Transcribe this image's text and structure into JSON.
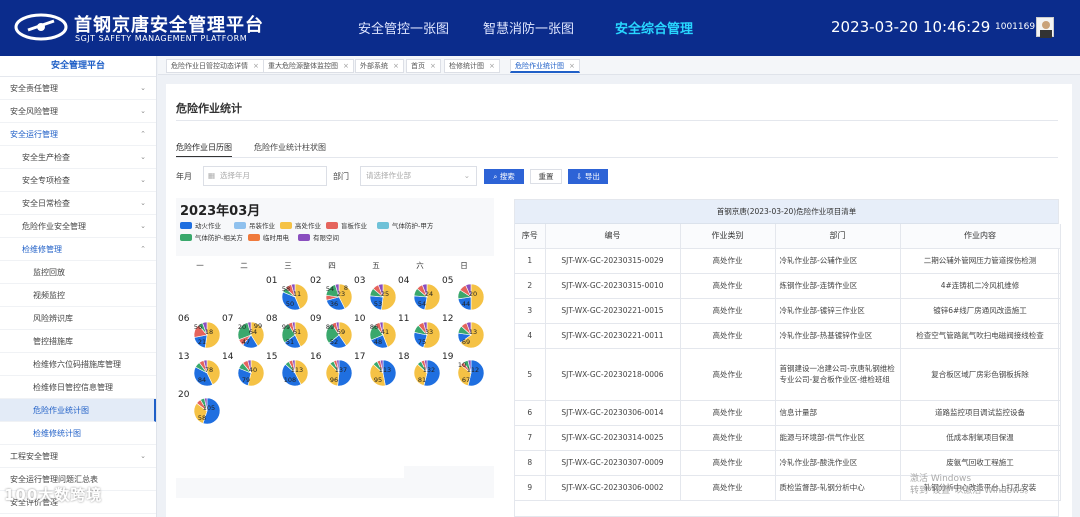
{
  "header": {
    "title": "首钢京唐安全管理平台",
    "subtitle": "SGJT SAFETY MANAGEMENT PLATFORM",
    "nav": [
      "安全管控一张图",
      "智慧消防一张图",
      "安全综合管理"
    ],
    "active_nav": "安全综合管理",
    "datetime": "2023-03-20 10:46:29",
    "user_id": "10011691"
  },
  "sidebar": {
    "title": "安全管理平台",
    "items": [
      {
        "label": "安全责任管理",
        "level": 1,
        "chevron": "⌄"
      },
      {
        "label": "安全风险管理",
        "level": 1,
        "chevron": "⌄"
      },
      {
        "label": "安全运行管理",
        "level": 1,
        "chevron": "⌃"
      },
      {
        "label": "安全生产检查",
        "level": 2,
        "chevron": "⌄"
      },
      {
        "label": "安全专项检查",
        "level": 2,
        "chevron": "⌄"
      },
      {
        "label": "安全日常检查",
        "level": 2,
        "chevron": "⌄"
      },
      {
        "label": "危险作业安全管理",
        "level": 2,
        "chevron": "⌄"
      },
      {
        "label": "检维修管理",
        "level": 2,
        "chevron": "⌃"
      },
      {
        "label": "监控回放",
        "level": 3,
        "chevron": ""
      },
      {
        "label": "视频监控",
        "level": 3,
        "chevron": ""
      },
      {
        "label": "风险辨识库",
        "level": 3,
        "chevron": ""
      },
      {
        "label": "管控措施库",
        "level": 3,
        "chevron": ""
      },
      {
        "label": "检维修六位码措施库管理",
        "level": 3,
        "chevron": ""
      },
      {
        "label": "检维修日管控信息管理",
        "level": 3,
        "chevron": ""
      },
      {
        "label": "危险作业统计图",
        "level": 3,
        "chevron": ""
      },
      {
        "label": "检维修统计图",
        "level": 3,
        "chevron": ""
      },
      {
        "label": "工程安全管理",
        "level": 1,
        "chevron": "⌄"
      },
      {
        "label": "安全运行管理问题汇总表",
        "level": 1,
        "chevron": ""
      },
      {
        "label": "安全评价管理",
        "level": 1,
        "chevron": ""
      }
    ]
  },
  "tabs": [
    {
      "label": "危险作业日管控动态详情"
    },
    {
      "label": "重大危险源整体监控图"
    },
    {
      "label": "外部系统"
    },
    {
      "label": "首页"
    },
    {
      "label": "检修统计图"
    },
    {
      "label": "危险作业统计图"
    }
  ],
  "page": {
    "title": "危险作业统计",
    "subtabs": [
      "危险作业日历图",
      "危险作业统计柱状图"
    ],
    "filters": {
      "month_label": "年月",
      "month_placeholder": "选择年月",
      "dept_label": "部门",
      "dept_placeholder": "请选择作业部"
    },
    "buttons": {
      "search": "搜索",
      "reset": "重置",
      "export": "导出"
    }
  },
  "calendar": {
    "title": "2023年03月",
    "weekdays": [
      "一",
      "二",
      "三",
      "四",
      "五",
      "六",
      "日"
    ],
    "legend": [
      {
        "name": "动火作业",
        "color": "#1f6fe0"
      },
      {
        "name": "吊装作业",
        "color": "#8fc1ee"
      },
      {
        "name": "高处作业",
        "color": "#f5c245"
      },
      {
        "name": "盲板作业",
        "color": "#e5645c"
      },
      {
        "name": "气体防护-甲方",
        "color": "#6fc2d8"
      },
      {
        "name": "气体防护-相关方",
        "color": "#3aa86c"
      },
      {
        "name": "临时用电",
        "color": "#f07a3c"
      },
      {
        "name": "有限空间",
        "color": "#8a4fbf"
      }
    ],
    "days": [
      {
        "day": "01",
        "labels": [
          "11",
          "50",
          "58"
        ],
        "slices": [
          {
            "c": "#f5c245",
            "v": 58
          },
          {
            "c": "#1f6fe0",
            "v": 50
          },
          {
            "c": "#3aa86c",
            "v": 8
          },
          {
            "c": "#e5645c",
            "v": 11
          },
          {
            "c": "#8a4fbf",
            "v": 6
          }
        ]
      },
      {
        "day": "02",
        "labels": [
          "23",
          "36",
          "54",
          "8"
        ],
        "slices": [
          {
            "c": "#f5c245",
            "v": 54
          },
          {
            "c": "#1f6fe0",
            "v": 36
          },
          {
            "c": "#e5645c",
            "v": 8
          },
          {
            "c": "#3aa86c",
            "v": 23
          },
          {
            "c": "#8a4fbf",
            "v": 6
          }
        ]
      },
      {
        "day": "03",
        "labels": [
          "25",
          "53"
        ],
        "slices": [
          {
            "c": "#f5c245",
            "v": 53
          },
          {
            "c": "#1f6fe0",
            "v": 25
          },
          {
            "c": "#3aa86c",
            "v": 10
          },
          {
            "c": "#e5645c",
            "v": 8
          },
          {
            "c": "#8a4fbf",
            "v": 6
          }
        ]
      },
      {
        "day": "04",
        "labels": [
          "24",
          "54"
        ],
        "slices": [
          {
            "c": "#f5c245",
            "v": 54
          },
          {
            "c": "#1f6fe0",
            "v": 24
          },
          {
            "c": "#3aa86c",
            "v": 10
          },
          {
            "c": "#e5645c",
            "v": 8
          },
          {
            "c": "#8a4fbf",
            "v": 6
          }
        ]
      },
      {
        "day": "05",
        "labels": [
          "20",
          "44"
        ],
        "slices": [
          {
            "c": "#f5c245",
            "v": 44
          },
          {
            "c": "#1f6fe0",
            "v": 20
          },
          {
            "c": "#3aa86c",
            "v": 10
          },
          {
            "c": "#e5645c",
            "v": 8
          },
          {
            "c": "#8a4fbf",
            "v": 6
          }
        ]
      },
      {
        "day": "06",
        "labels": [
          "18",
          "21",
          "56"
        ],
        "slices": [
          {
            "c": "#f5c245",
            "v": 56
          },
          {
            "c": "#1f6fe0",
            "v": 21
          },
          {
            "c": "#e5645c",
            "v": 18
          },
          {
            "c": "#3aa86c",
            "v": 6
          },
          {
            "c": "#8a4fbf",
            "v": 6
          }
        ]
      },
      {
        "day": "07",
        "labels": [
          "64",
          "47",
          "20",
          "99"
        ],
        "slices": [
          {
            "c": "#f5c245",
            "v": 99
          },
          {
            "c": "#1f6fe0",
            "v": 47
          },
          {
            "c": "#e5645c",
            "v": 20
          },
          {
            "c": "#3aa86c",
            "v": 64
          },
          {
            "c": "#8a4fbf",
            "v": 10
          }
        ]
      },
      {
        "day": "08",
        "labels": [
          "61",
          "51",
          "99"
        ],
        "slices": [
          {
            "c": "#f5c245",
            "v": 99
          },
          {
            "c": "#1f6fe0",
            "v": 51
          },
          {
            "c": "#3aa86c",
            "v": 61
          },
          {
            "c": "#e5645c",
            "v": 12
          },
          {
            "c": "#8a4fbf",
            "v": 8
          }
        ]
      },
      {
        "day": "09",
        "labels": [
          "59",
          "52",
          "89"
        ],
        "slices": [
          {
            "c": "#f5c245",
            "v": 89
          },
          {
            "c": "#1f6fe0",
            "v": 52
          },
          {
            "c": "#3aa86c",
            "v": 59
          },
          {
            "c": "#e5645c",
            "v": 12
          },
          {
            "c": "#8a4fbf",
            "v": 8
          }
        ]
      },
      {
        "day": "10",
        "labels": [
          "41",
          "48",
          "86"
        ],
        "slices": [
          {
            "c": "#f5c245",
            "v": 86
          },
          {
            "c": "#1f6fe0",
            "v": 48
          },
          {
            "c": "#3aa86c",
            "v": 41
          },
          {
            "c": "#e5645c",
            "v": 12
          },
          {
            "c": "#8a4fbf",
            "v": 8
          }
        ]
      },
      {
        "day": "11",
        "labels": [
          "33",
          "75"
        ],
        "slices": [
          {
            "c": "#f5c245",
            "v": 75
          },
          {
            "c": "#1f6fe0",
            "v": 33
          },
          {
            "c": "#3aa86c",
            "v": 14
          },
          {
            "c": "#e5645c",
            "v": 10
          },
          {
            "c": "#8a4fbf",
            "v": 6
          }
        ]
      },
      {
        "day": "12",
        "labels": [
          "13",
          "69"
        ],
        "slices": [
          {
            "c": "#f5c245",
            "v": 69
          },
          {
            "c": "#1f6fe0",
            "v": 13
          },
          {
            "c": "#3aa86c",
            "v": 10
          },
          {
            "c": "#e5645c",
            "v": 8
          },
          {
            "c": "#8a4fbf",
            "v": 6
          }
        ]
      },
      {
        "day": "13",
        "labels": [
          "78",
          "84"
        ],
        "slices": [
          {
            "c": "#f5c245",
            "v": 84
          },
          {
            "c": "#1f6fe0",
            "v": 78
          },
          {
            "c": "#3aa86c",
            "v": 14
          },
          {
            "c": "#e5645c",
            "v": 12
          },
          {
            "c": "#8a4fbf",
            "v": 8
          }
        ]
      },
      {
        "day": "14",
        "labels": [
          "40",
          "79"
        ],
        "slices": [
          {
            "c": "#f5c245",
            "v": 79
          },
          {
            "c": "#1f6fe0",
            "v": 40
          },
          {
            "c": "#3aa86c",
            "v": 12
          },
          {
            "c": "#e5645c",
            "v": 10
          },
          {
            "c": "#8a4fbf",
            "v": 6
          }
        ]
      },
      {
        "day": "15",
        "labels": [
          "113",
          "108"
        ],
        "slices": [
          {
            "c": "#f5c245",
            "v": 108
          },
          {
            "c": "#1f6fe0",
            "v": 113
          },
          {
            "c": "#3aa86c",
            "v": 14
          },
          {
            "c": "#e5645c",
            "v": 12
          },
          {
            "c": "#8a4fbf",
            "v": 8
          }
        ]
      },
      {
        "day": "16",
        "labels": [
          "137",
          "96"
        ],
        "slices": [
          {
            "c": "#1f6fe0",
            "v": 137
          },
          {
            "c": "#f5c245",
            "v": 96
          },
          {
            "c": "#3aa86c",
            "v": 14
          },
          {
            "c": "#e5645c",
            "v": 10
          },
          {
            "c": "#8a4fbf",
            "v": 8
          }
        ]
      },
      {
        "day": "17",
        "labels": [
          "113",
          "95"
        ],
        "slices": [
          {
            "c": "#1f6fe0",
            "v": 113
          },
          {
            "c": "#f5c245",
            "v": 95
          },
          {
            "c": "#3aa86c",
            "v": 14
          },
          {
            "c": "#e5645c",
            "v": 10
          },
          {
            "c": "#8a4fbf",
            "v": 8
          }
        ]
      },
      {
        "day": "18",
        "labels": [
          "132",
          "81"
        ],
        "slices": [
          {
            "c": "#1f6fe0",
            "v": 132
          },
          {
            "c": "#f5c245",
            "v": 81
          },
          {
            "c": "#3aa86c",
            "v": 14
          },
          {
            "c": "#e5645c",
            "v": 10
          },
          {
            "c": "#8a4fbf",
            "v": 8
          }
        ]
      },
      {
        "day": "19",
        "labels": [
          "112",
          "67",
          "10"
        ],
        "slices": [
          {
            "c": "#1f6fe0",
            "v": 112
          },
          {
            "c": "#f5c245",
            "v": 67
          },
          {
            "c": "#e5645c",
            "v": 10
          },
          {
            "c": "#3aa86c",
            "v": 12
          },
          {
            "c": "#8a4fbf",
            "v": 8
          }
        ]
      },
      {
        "day": "20",
        "labels": [
          "105",
          "58"
        ],
        "slices": [
          {
            "c": "#1f6fe0",
            "v": 105
          },
          {
            "c": "#f5c245",
            "v": 58
          },
          {
            "c": "#e5645c",
            "v": 12
          },
          {
            "c": "#3aa86c",
            "v": 10
          },
          {
            "c": "#8a4fbf",
            "v": 6
          }
        ]
      }
    ]
  },
  "table": {
    "caption": "首钢京唐(2023-03-20)危险作业项目清单",
    "columns": [
      "序号",
      "编号",
      "作业类别",
      "部门",
      "作业内容"
    ],
    "rows": [
      [
        "1",
        "SJT-WX-GC-20230315-0029",
        "高处作业",
        "冷轧作业部-公辅作业区",
        "二期公辅外管网压力管道探伤检测"
      ],
      [
        "2",
        "SJT-WX-GC-20230315-0010",
        "高处作业",
        "炼钢作业部-连铸作业区",
        "4#连铸机二冷风机维修"
      ],
      [
        "3",
        "SJT-WX-GC-20230221-0015",
        "高处作业",
        "冷轧作业部-镀锌三作业区",
        "镀锌6#线厂房通风改造施工"
      ],
      [
        "4",
        "SJT-WX-GC-20230221-0011",
        "高处作业",
        "冷轧作业部-热基镀锌作业区",
        "检查空气管路氮气吹扫电磁阀接线检查"
      ],
      [
        "5",
        "SJT-WX-GC-20230218-0006",
        "高处作业",
        "首钢建设一冶建公司-京唐轧钢维检专业公司-复合板作业区-维检班组",
        "复合板区域厂房彩色钢板拆除"
      ],
      [
        "6",
        "SJT-WX-GC-20230306-0014",
        "高处作业",
        "信息计量部",
        "道路监控项目调试监控设备"
      ],
      [
        "7",
        "SJT-WX-GC-20230314-0025",
        "高处作业",
        "能源与环境部-供气作业区",
        "低成本制氧项目保温"
      ],
      [
        "8",
        "SJT-WX-GC-20230307-0009",
        "高处作业",
        "冷轧作业部-酸洗作业区",
        "废氨气回收工程施工"
      ],
      [
        "9",
        "SJT-WX-GC-20230306-0002",
        "高处作业",
        "质检监督部-轧钢分析中心",
        "轧钢分析中心改造平台上打孔安装"
      ]
    ]
  },
  "watermark": "100大数跨境",
  "os_watermark": [
    "激活 Windows",
    "转到\"设置\"以激活 Windows。"
  ],
  "colors": {
    "header_bg": "#0b2c8c",
    "accent": "#2d63d6",
    "active_nav": "#28d7ff"
  }
}
